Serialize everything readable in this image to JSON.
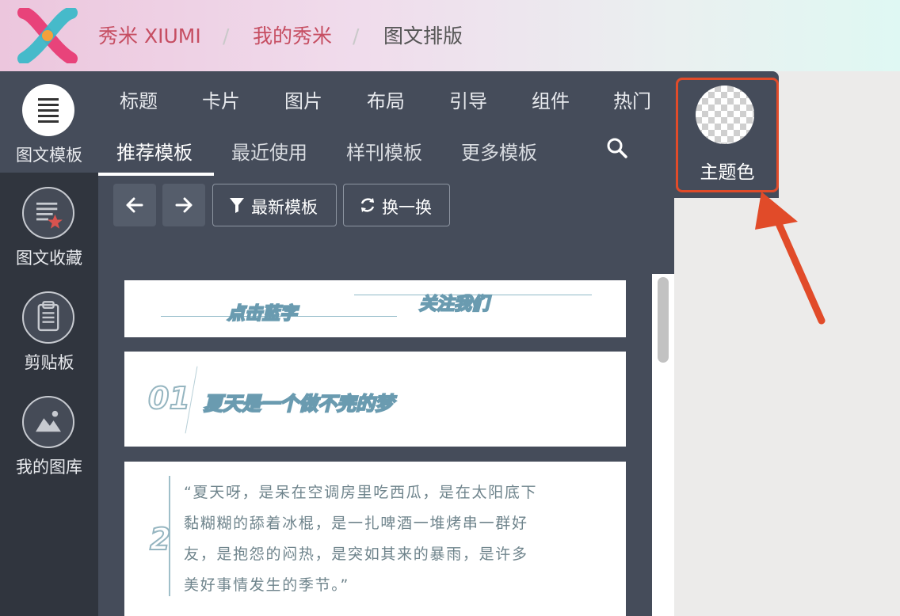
{
  "breadcrumb": {
    "brand": "秀米 XIUMI",
    "home": "我的秀米",
    "current": "图文排版",
    "separator": "/"
  },
  "left_nav": {
    "items": [
      {
        "label": "图文模板",
        "icon": "template-list-icon",
        "active": true
      },
      {
        "label": "图文收藏",
        "icon": "favorites-icon",
        "active": false
      },
      {
        "label": "剪贴板",
        "icon": "clipboard-icon",
        "active": false
      },
      {
        "label": "我的图库",
        "icon": "gallery-icon",
        "active": false
      }
    ]
  },
  "category_tabs": [
    "标题",
    "卡片",
    "图片",
    "布局",
    "引导",
    "组件",
    "热门"
  ],
  "sub_tabs": {
    "items": [
      "推荐模板",
      "最近使用",
      "样刊模板",
      "更多模板"
    ],
    "selected": "推荐模板"
  },
  "toolbar": {
    "prev_icon": "arrow-left-icon",
    "next_icon": "arrow-right-icon",
    "filter_label": "最新模板",
    "shuffle_label": "换一换"
  },
  "templates": {
    "card1": {
      "left_text": "点击蓝字",
      "right_text": "关注我们"
    },
    "card2": {
      "number": "01",
      "title": "夏天是一个做不完的梦"
    },
    "card3": {
      "number": "2",
      "lines": [
        "“夏天呀，是呆在空调房里吃西瓜，是在太阳底下",
        "黏糊糊的舔着冰棍，是一扎啤酒一堆烤串一群好",
        "友，是抱怨的闷热，是突如其来的暴雨，是许多",
        "美好事情发生的季节。”"
      ]
    }
  },
  "theme": {
    "label": "主题色",
    "swatch": "transparent-checker"
  },
  "colors": {
    "accent": "#c64e62",
    "highlight": "#e14b29",
    "panel": "#454c5a",
    "rail": "#30353e"
  }
}
